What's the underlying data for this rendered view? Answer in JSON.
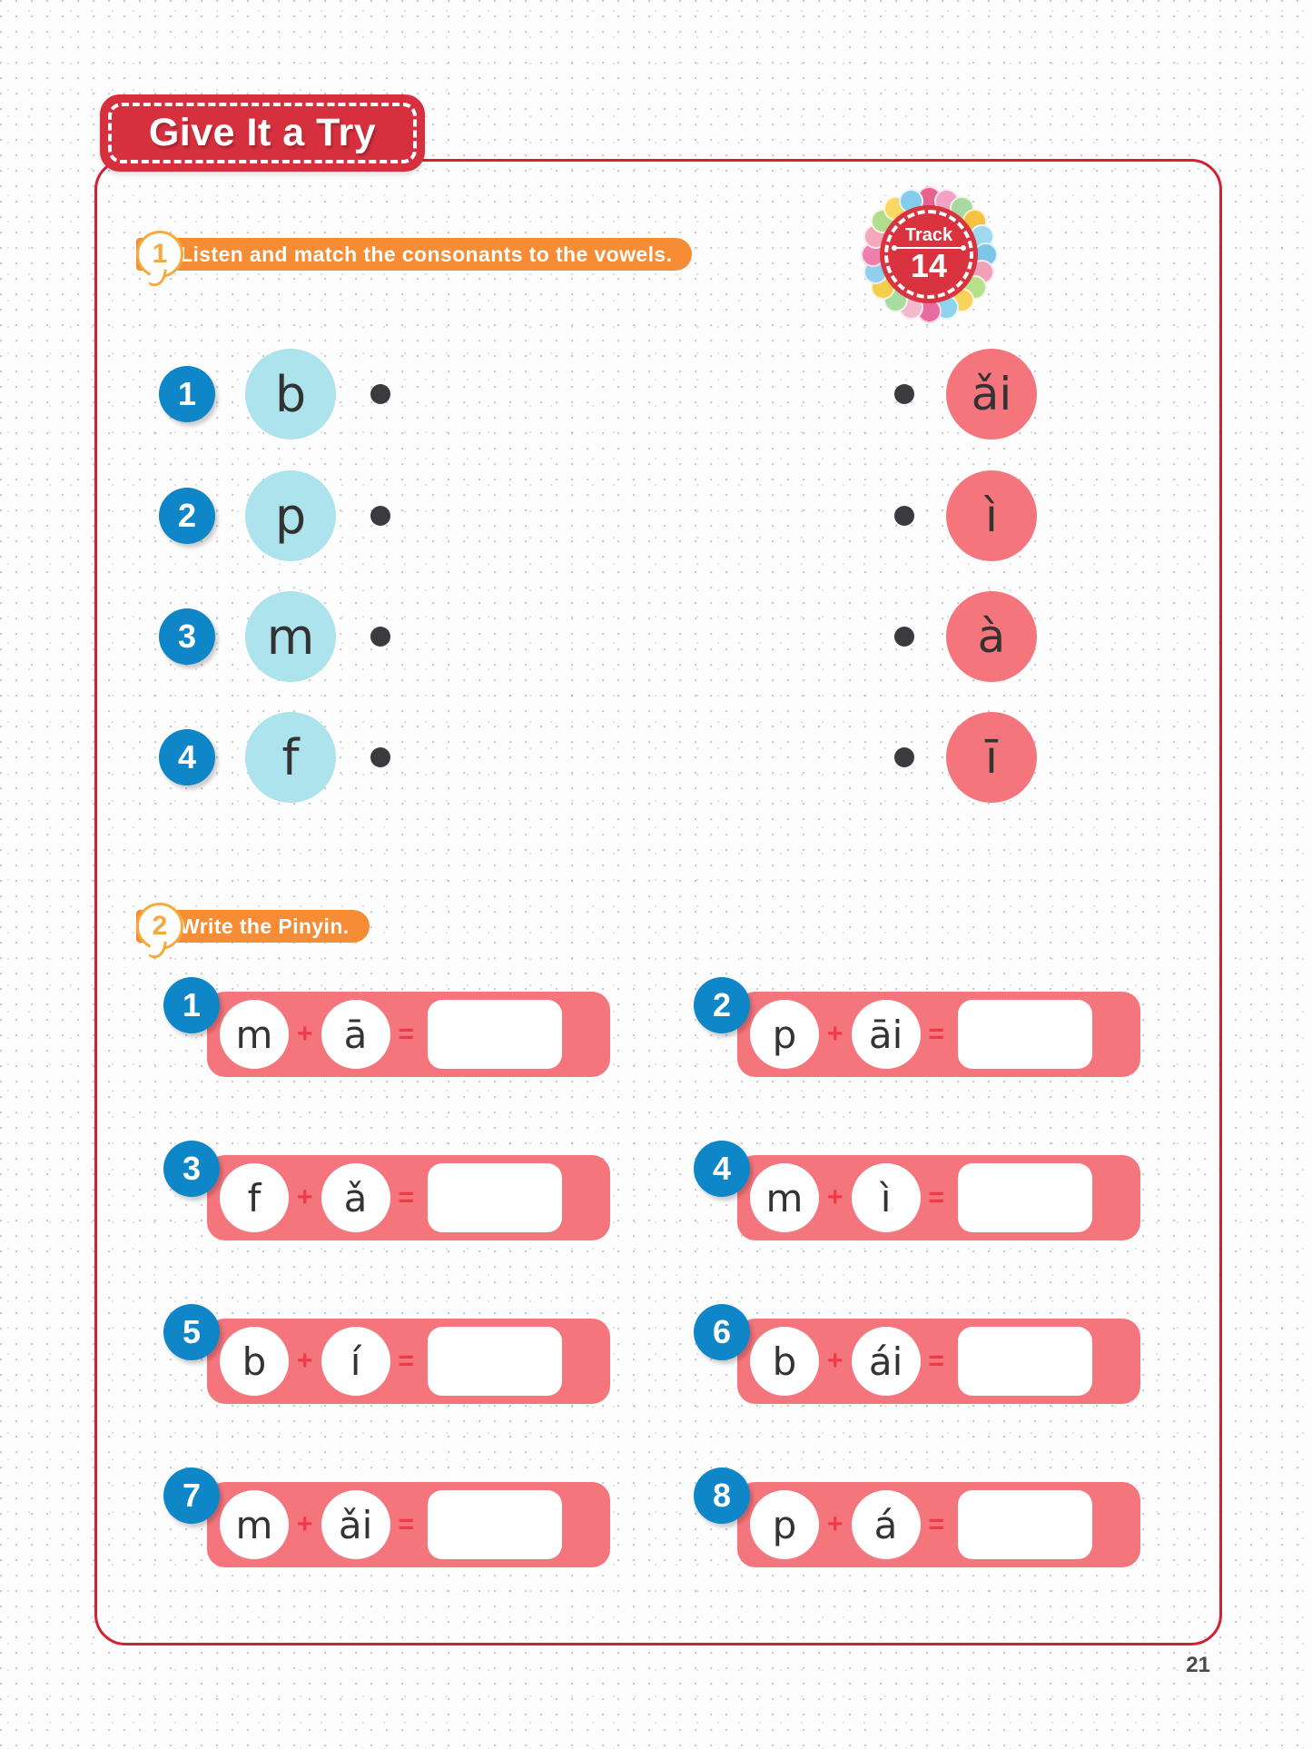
{
  "page": {
    "title": "Give It a Try",
    "page_number": "21"
  },
  "track": {
    "label": "Track",
    "number": "14",
    "bubble_colors": [
      "#e8628e",
      "#f3a3c1",
      "#a9d8a0",
      "#f5c242",
      "#9fd9f0",
      "#7cc6e8",
      "#f0a0b8",
      "#b7e08a",
      "#f9d35b",
      "#8fd4ef",
      "#e76ba0",
      "#f6b8cf",
      "#a8dca2",
      "#f4cd4d",
      "#92cfea",
      "#ef7fae",
      "#f5a8bd",
      "#b0dd8e",
      "#fad75e",
      "#85ccec"
    ]
  },
  "exercise1": {
    "number": "1",
    "instruction": "Listen and match the consonants to the vowels.",
    "consonants": [
      {
        "num": "1",
        "letter": "b"
      },
      {
        "num": "2",
        "letter": "p"
      },
      {
        "num": "3",
        "letter": "m"
      },
      {
        "num": "4",
        "letter": "f"
      }
    ],
    "vowels": [
      {
        "letter": "ǎi"
      },
      {
        "letter": "ì"
      },
      {
        "letter": "à"
      },
      {
        "letter": "ī"
      }
    ]
  },
  "exercise2": {
    "number": "2",
    "instruction": "Write the Pinyin.",
    "plus": "+",
    "equals": "=",
    "items": [
      {
        "num": "1",
        "consonant": "m",
        "vowel": "ā",
        "answer": ""
      },
      {
        "num": "2",
        "consonant": "p",
        "vowel": "āi",
        "answer": ""
      },
      {
        "num": "3",
        "consonant": "f",
        "vowel": "ǎ",
        "answer": ""
      },
      {
        "num": "4",
        "consonant": "m",
        "vowel": "ì",
        "answer": ""
      },
      {
        "num": "5",
        "consonant": "b",
        "vowel": "í",
        "answer": ""
      },
      {
        "num": "6",
        "consonant": "b",
        "vowel": "ái",
        "answer": ""
      },
      {
        "num": "7",
        "consonant": "m",
        "vowel": "ǎi",
        "answer": ""
      },
      {
        "num": "8",
        "consonant": "p",
        "vowel": "á",
        "answer": ""
      }
    ]
  },
  "colors": {
    "frame_red": "#cf2233",
    "banner_red": "#d6303f",
    "orange": "#f68d35",
    "blue": "#0f86c8",
    "light_blue": "#ace3ec",
    "pink": "#f4757c"
  }
}
